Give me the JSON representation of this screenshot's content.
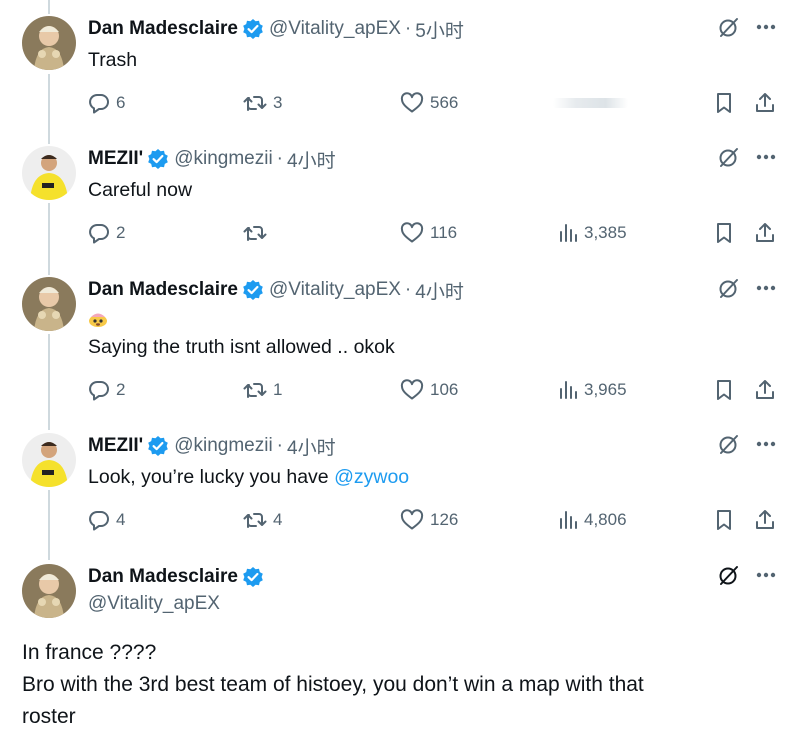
{
  "tweets": [
    {
      "name": "Dan Madesclaire",
      "handle": "@Vitality_apEX",
      "dot": "·",
      "time": "5小时",
      "text": "Trash",
      "replies": "6",
      "retweets": "3",
      "likes": "566",
      "views": ""
    },
    {
      "name": "MEZII'",
      "handle": "@kingmezii",
      "dot": "·",
      "time": "4小时",
      "text": "Careful now",
      "replies": "2",
      "retweets": "",
      "likes": "116",
      "views": "3,385"
    },
    {
      "name": "Dan Madesclaire",
      "handle": "@Vitality_apEX",
      "dot": "·",
      "time": "4小时",
      "text": "Saying the truth isnt allowed .. okok",
      "replies": "2",
      "retweets": "1",
      "likes": "106",
      "views": "3,965"
    },
    {
      "name": "MEZII'",
      "handle": "@kingmezii",
      "dot": "·",
      "time": "4小时",
      "text": "Look, you’re lucky you have ",
      "mention": "@zywoo",
      "replies": "4",
      "retweets": "4",
      "likes": "126",
      "views": "4,806"
    }
  ],
  "main_tweet": {
    "name": "Dan Madesclaire",
    "handle": "@Vitality_apEX",
    "lines": [
      "In france ????",
      "Bro with the 3rd best team of histoey, you don’t win a map with that",
      "roster"
    ]
  },
  "colors": {
    "text": "#0f1419",
    "muted": "#536471",
    "verified": "#1d9bf0",
    "link": "#1d9bf0",
    "thread_line": "#cfd9de"
  },
  "icons": [
    "verified-badge-icon",
    "grok-icon",
    "more-icon",
    "reply-icon",
    "retweet-icon",
    "like-icon",
    "views-icon",
    "bookmark-icon",
    "share-icon"
  ]
}
